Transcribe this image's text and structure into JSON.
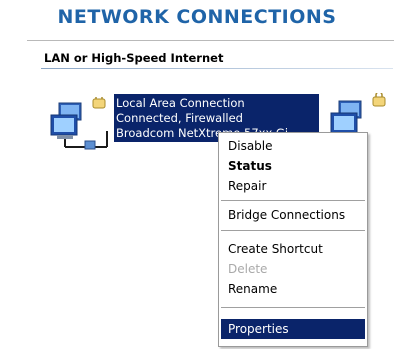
{
  "title": "NETWORK CONNECTIONS",
  "group": {
    "header": "LAN or High-Speed Internet"
  },
  "connection": {
    "name": "Local Area Connection",
    "status": "Connected, Firewalled",
    "device": "Broadcom NetXtreme 57xx Gi"
  },
  "context_menu": {
    "items": [
      {
        "label": "Disable"
      },
      {
        "label": "Status",
        "bold": true
      },
      {
        "label": "Repair"
      },
      {
        "label": "Bridge Connections"
      },
      {
        "label": "Create Shortcut"
      },
      {
        "label": "Delete",
        "disabled": true
      },
      {
        "label": "Rename"
      },
      {
        "label": "Properties",
        "selected": true
      }
    ]
  },
  "colors": {
    "title": "#1f64a8",
    "selection": "#0a246a",
    "menu_border": "#9a9a9a"
  }
}
